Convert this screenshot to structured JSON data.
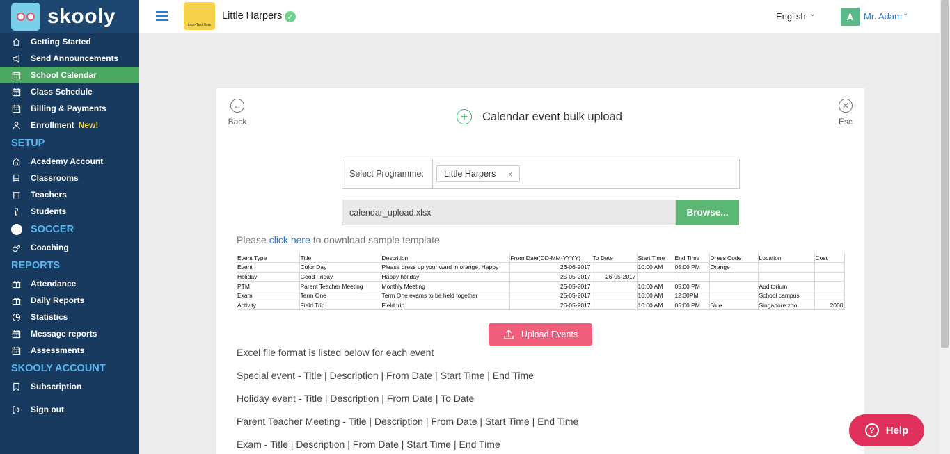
{
  "brand": {
    "name": "skooly"
  },
  "sidebar": {
    "items_main": [
      {
        "label": "Getting Started",
        "icon": "home-icon"
      },
      {
        "label": "Send Announcements",
        "icon": "megaphone-icon"
      },
      {
        "label": "School Calendar",
        "icon": "calendar-icon",
        "active": true
      },
      {
        "label": "Class Schedule",
        "icon": "calendar-icon"
      },
      {
        "label": "Billing & Payments",
        "icon": "calendar-icon"
      },
      {
        "label": "Enrollment",
        "icon": "user-icon",
        "badge": "New!"
      }
    ],
    "setup_title": "SETUP",
    "items_setup": [
      {
        "label": "Academy Account",
        "icon": "building-icon"
      },
      {
        "label": "Classrooms",
        "icon": "chair-icon"
      },
      {
        "label": "Teachers",
        "icon": "desk-icon"
      },
      {
        "label": "Students",
        "icon": "student-icon"
      }
    ],
    "soccer_title": "SOCCER",
    "items_soccer": [
      {
        "label": "Coaching",
        "icon": "whistle-icon"
      }
    ],
    "reports_title": "REPORTS",
    "items_reports": [
      {
        "label": "Attendance",
        "icon": "gift-icon"
      },
      {
        "label": "Daily Reports",
        "icon": "gift-icon"
      },
      {
        "label": "Statistics",
        "icon": "pie-icon"
      },
      {
        "label": "Message reports",
        "icon": "calendar-icon"
      },
      {
        "label": "Assessments",
        "icon": "calendar-icon"
      }
    ],
    "account_title": "SKOOLY ACCOUNT",
    "items_account": [
      {
        "label": "Subscription",
        "icon": "bookmark-icon"
      }
    ],
    "signout": {
      "label": "Sign out",
      "icon": "signout-icon"
    }
  },
  "topbar": {
    "school_logo_text": "Logo Text Here",
    "school_name": "Little Harpers",
    "language": "English",
    "user_initial": "A",
    "user_name": "Mr. Adam"
  },
  "card": {
    "back_label": "Back",
    "esc_label": "Esc",
    "title": "Calendar event bulk upload",
    "programme_label": "Select Programme:",
    "programme_tag": "Little Harpers",
    "programme_tag_remove": "x",
    "file_name": "calendar_upload.xlsx",
    "browse_label": "Browse...",
    "download_prefix": "Please",
    "download_link": "click here",
    "download_suffix": "to download sample template",
    "upload_label": "Upload Events",
    "format_lines": [
      "Excel file format is listed below for each event",
      "Special event - Title | Description | From Date | Start Time | End Time",
      "Holiday event - Title | Description | From Date | To Date",
      "Parent Teacher Meeting - Title | Description | From Date | Start Time | End Time",
      "Exam - Title | Description | From Date | Start Time | End Time"
    ]
  },
  "sample_table": {
    "headers": [
      "Event Type",
      "Title",
      "Descrition",
      "From Date(DD-MM-YYYY)",
      "To Date",
      "Start Time",
      "End Time",
      "Dress Code",
      "Location",
      "Cost"
    ],
    "rows": [
      [
        "Event",
        "Color Day",
        "Please dress up your ward in orange. Happy",
        "26-06-2017",
        "",
        "10:00 AM",
        "05:00 PM",
        "Orange",
        "",
        ""
      ],
      [
        "Holiday",
        "Good Friday",
        "Happy holiday",
        "25-05-2017",
        "26-05-2017",
        "",
        "",
        "",
        "",
        ""
      ],
      [
        "PTM",
        "Parent Teacher Meeting",
        "Monthly Meeting",
        "25-05-2017",
        "",
        "10:00 AM",
        "05:00 PM",
        "",
        "Auditorium",
        ""
      ],
      [
        "Exam",
        "Term One",
        "Term One exams to be held together",
        "25-05-2017",
        "",
        "10:00 AM",
        "12:30PM",
        "",
        "School campus",
        ""
      ],
      [
        "Activity",
        "Field Trip",
        "Field trip",
        "26-05-2017",
        "",
        "10:00 AM",
        "05:00 PM",
        "Blue",
        "Singapore zoo",
        "2000"
      ]
    ]
  },
  "help": {
    "label": "Help"
  },
  "colors": {
    "sidebar_bg": "#173a5e",
    "active_item": "#4ba862",
    "section_title": "#58b6f0",
    "browse_button": "#5bb774",
    "upload_button": "#ef5f7b",
    "help_button": "#e0315c",
    "link": "#2a7bd2"
  }
}
